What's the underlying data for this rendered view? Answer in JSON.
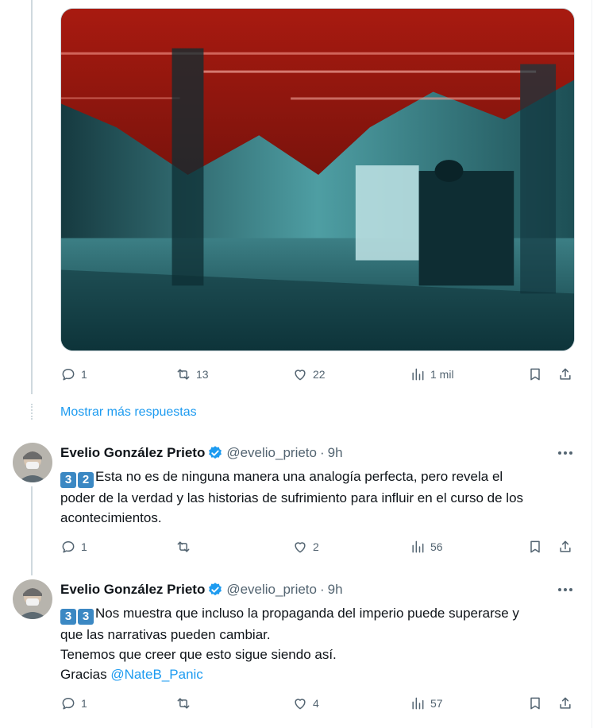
{
  "top_tweet": {
    "image_alt": "Imagen",
    "actions": {
      "reply_count": "1",
      "retweet_count": "13",
      "like_count": "22",
      "view_count": "1 mil"
    }
  },
  "show_more_label": "Mostrar más respuestas",
  "tweets": [
    {
      "name": "Evelio González Prieto",
      "handle": "@evelio_prieto",
      "sep": "·",
      "time": "9h",
      "keycaps": [
        "3",
        "2"
      ],
      "text_lines": [
        "Esta no es de ninguna manera una analogía perfecta, pero revela el",
        "poder de la verdad y las historias de sufrimiento para influir en el curso de los",
        "acontecimientos."
      ],
      "actions": {
        "reply_count": "1",
        "retweet_count": "",
        "like_count": "2",
        "view_count": "56"
      }
    },
    {
      "name": "Evelio González Prieto",
      "handle": "@evelio_prieto",
      "sep": "·",
      "time": "9h",
      "keycaps": [
        "3",
        "3"
      ],
      "text_lines": [
        "Nos muestra que incluso la propaganda del imperio puede superarse y",
        "que las narrativas pueden cambiar.",
        "Tenemos que creer que esto sigue siendo así.",
        "Gracias"
      ],
      "mention": "@NateB_Panic",
      "actions": {
        "reply_count": "1",
        "retweet_count": "",
        "like_count": "4",
        "view_count": "57"
      }
    }
  ],
  "colors": {
    "accent": "#1d9bf0",
    "muted": "#536471",
    "verified": "#1d9bf0",
    "keycap": "#3b88c3"
  }
}
